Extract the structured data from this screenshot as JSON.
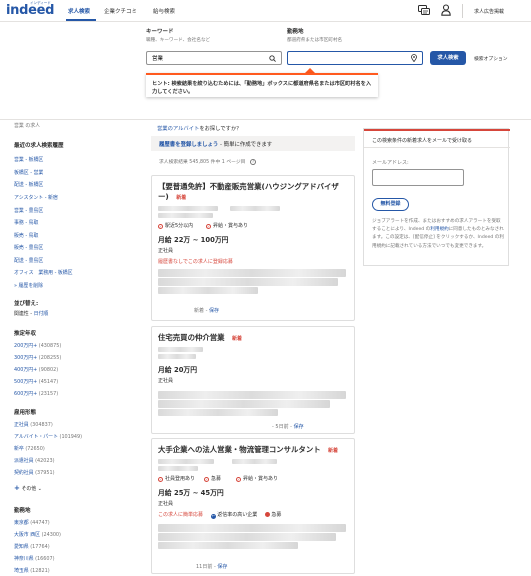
{
  "header": {
    "logo": "indeed",
    "logo_sub": "インディード",
    "nav": [
      "求人検索",
      "企業クチコミ",
      "給与検索"
    ],
    "post_job": "求人広告掲載"
  },
  "search": {
    "keyword_label": "キーワード",
    "keyword_sub": "職種、キーワード、会社名など",
    "keyword_value": "営業",
    "location_label": "勤務地",
    "location_sub": "都道府県または市区町村名",
    "location_value": "",
    "button": "求人検索",
    "advanced": "検索オプション",
    "hint": "ヒント: 検索結果を絞り込むためには、「勤務地」ボックスに都道府県名または市区町村名を入力してください。"
  },
  "filters": {
    "region_title": "営業 の求人",
    "recent_title": "最近の求人検索履歴",
    "recent": [
      "営業 - 板橋区",
      "板橋区 - 営業",
      "配送 - 板橋区",
      "アシスタント - 新宿",
      "営業 - 豊島区",
      "事務 - 鳥取",
      "販売 - 鳥取",
      "販売 - 豊島区",
      "配送 - 豊島区",
      "オフィス　業務用 - 板橋区"
    ],
    "clear_history": "» 履歴を削除",
    "sort_title": "並び替え:",
    "sort_relevance": "関連性",
    "sort_sep": " - ",
    "sort_date": "日付順",
    "salary_title": "推定年収",
    "salary": [
      [
        "200万円+",
        "(430875)"
      ],
      [
        "300万円+",
        "(208255)"
      ],
      [
        "400万円+",
        "(90802)"
      ],
      [
        "500万円+",
        "(45147)"
      ],
      [
        "600万円+",
        "(23157)"
      ]
    ],
    "type_title": "雇用形態",
    "types": [
      [
        "正社員",
        "(304837)"
      ],
      [
        "アルバイト・パート",
        "(101949)"
      ],
      [
        "新卒",
        "(72650)"
      ],
      [
        "派遣社員",
        "(42023)"
      ],
      [
        "契約社員",
        "(37951)"
      ]
    ],
    "more": "その他",
    "loc_title": "勤務地",
    "locations": [
      [
        "東京都",
        "(44747)"
      ],
      [
        "大阪市 西区",
        "(24300)"
      ],
      [
        "愛知県",
        "(17764)"
      ],
      [
        "神奈川県",
        "(16607)"
      ],
      [
        "埼玉県",
        "(12821)"
      ]
    ]
  },
  "main": {
    "part_time_link": "営業のアルバイト",
    "part_time_rest": "をお探しですか？",
    "resume_link": "履歴書を登録しましょう",
    "resume_rest": " - 簡単に作成できます",
    "count": "求人検索結果 545,805 件中 1 ページ目",
    "jobs": [
      {
        "title": "【要普通免許】不動産販売営業(ハウジングアドバイザー)",
        "new": "新着",
        "tags": [
          "駅近5分以内",
          "昇給・賞与あり"
        ],
        "salary": "月給 22万 ~ 100万円",
        "type": "正社員",
        "apply": "履歴書なしでこの求人に登録応募",
        "footer_new": "新着",
        "footer_sep": " - ",
        "save": "保存"
      },
      {
        "title": "住宅売買の仲介営業",
        "new": "新着",
        "salary": "月給 20万円",
        "type": "正社員",
        "footer_days": "5日前",
        "footer_sep": " - ",
        "save": "保存"
      },
      {
        "title": "大手企業への法人営業・物流管理コンサルタント",
        "new": "新着",
        "tags": [
          "社員登用あり",
          "急募",
          "昇給・賞与あり"
        ],
        "salary": "月給 25万 ~ 45万円",
        "type": "正社員",
        "apply": "この求人に簡単応募",
        "badge1": "返信率の高い企業",
        "badge2": "急募",
        "footer_days": "11日前",
        "footer_sep": " - ",
        "save": "保存"
      }
    ]
  },
  "alert": {
    "title": "この検索条件の新着求人をメールで受け取る",
    "email_label": "メールアドレス:",
    "button": "無料登録",
    "desc_a": "ジョブアラートを作成、またはおすすめの求人アラートを受取することにより、Indeed の",
    "desc_link": "利用規約",
    "desc_b": "に同意したものとみなされます。この設定は、[配信停止] をクリックするか、Indeed の利用規約に記載されている方法でいつでも変更できます。"
  },
  "colors": {
    "brand": "#2557a7",
    "new_badge": "#d6463b",
    "hint_accent": "#ff5a1f"
  }
}
